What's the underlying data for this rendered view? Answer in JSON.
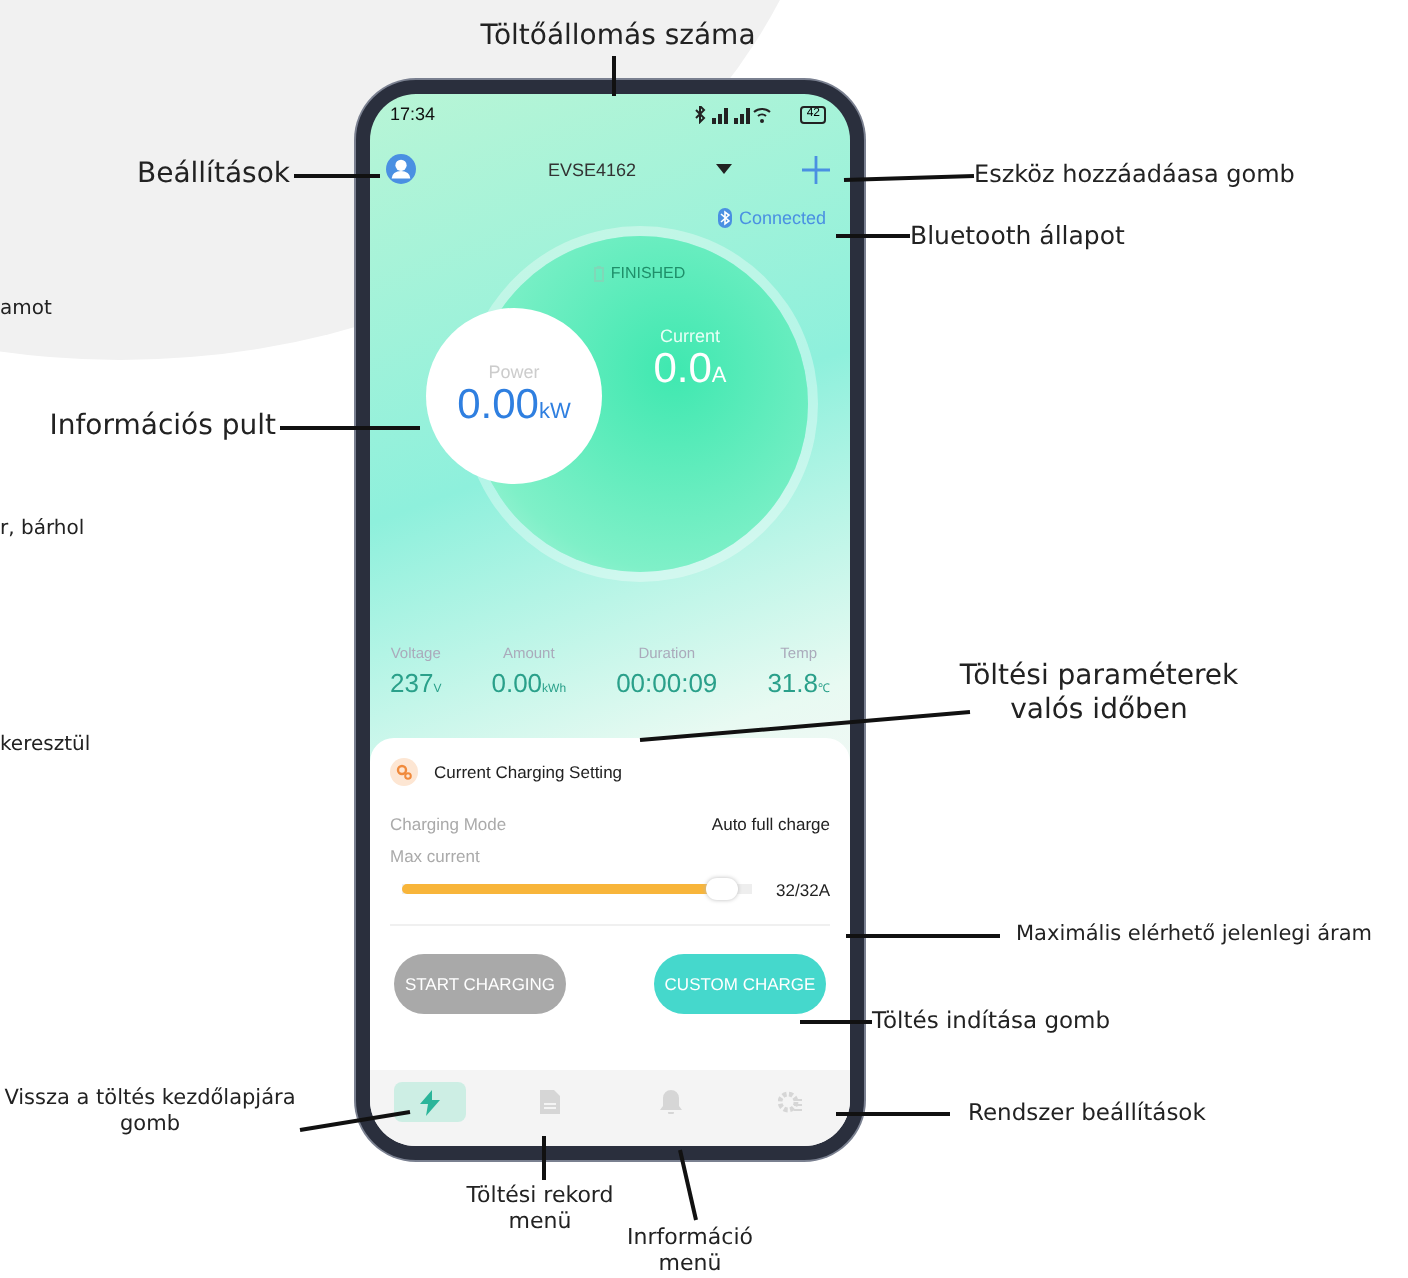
{
  "background_texts": [
    "amot",
    "r, bárhol",
    "keresztül"
  ],
  "phone": {
    "status_time": "17:34",
    "battery": "42",
    "header": {
      "station": "EVSE4162",
      "connection": "Connected"
    },
    "status": "FINISHED",
    "power": {
      "label": "Power",
      "value": "0.00",
      "unit": "kW"
    },
    "current": {
      "label": "Current",
      "value": "0.0",
      "unit": "A"
    },
    "stats": [
      {
        "label": "Voltage",
        "value": "237",
        "unit": "V"
      },
      {
        "label": "Amount",
        "value": "0.00",
        "unit": "kWh"
      },
      {
        "label": "Duration",
        "value": "00:00:09"
      },
      {
        "label": "Temp",
        "value": "31.8",
        "unit": "℃"
      }
    ],
    "setting": {
      "title": "Current Charging Setting",
      "mode_label": "Charging Mode",
      "mode_value": "Auto full charge",
      "max_label": "Max current",
      "level": 0.96,
      "reading": "32/32A"
    },
    "buttons": [
      {
        "label": "START CHARGING",
        "disabled": true
      },
      {
        "label": "CUSTOM CHARGE",
        "disabled": false
      }
    ],
    "nav": [
      {
        "kind": "charge",
        "selected": true
      },
      {
        "kind": "record",
        "selected": false
      },
      {
        "kind": "bell",
        "selected": false
      },
      {
        "kind": "gear",
        "selected": false
      }
    ]
  },
  "callouts": [
    {
      "lines": [
        "Töltőállomás száma"
      ]
    },
    {
      "lines": [
        "Beállítások"
      ]
    },
    {
      "lines": [
        "Eszköz hozzáadáasa gomb"
      ]
    },
    {
      "lines": [
        "Bluetooth  állapot"
      ]
    },
    {
      "lines": [
        "Információs pult"
      ]
    },
    {
      "lines": [
        "Töltési paraméterek",
        "valós időben"
      ]
    },
    {
      "lines": [
        "Maximális elérhető jelenlegi áram"
      ]
    },
    {
      "lines": [
        "Töltés indítása gomb"
      ]
    },
    {
      "lines": [
        "Vissza a töltés kezdőlapjára",
        "gomb"
      ]
    },
    {
      "lines": [
        "Rendszer beállítások"
      ]
    },
    {
      "lines": [
        "Töltési rekord",
        "menü"
      ]
    },
    {
      "lines": [
        "Inrformáció",
        "menü"
      ]
    }
  ]
}
